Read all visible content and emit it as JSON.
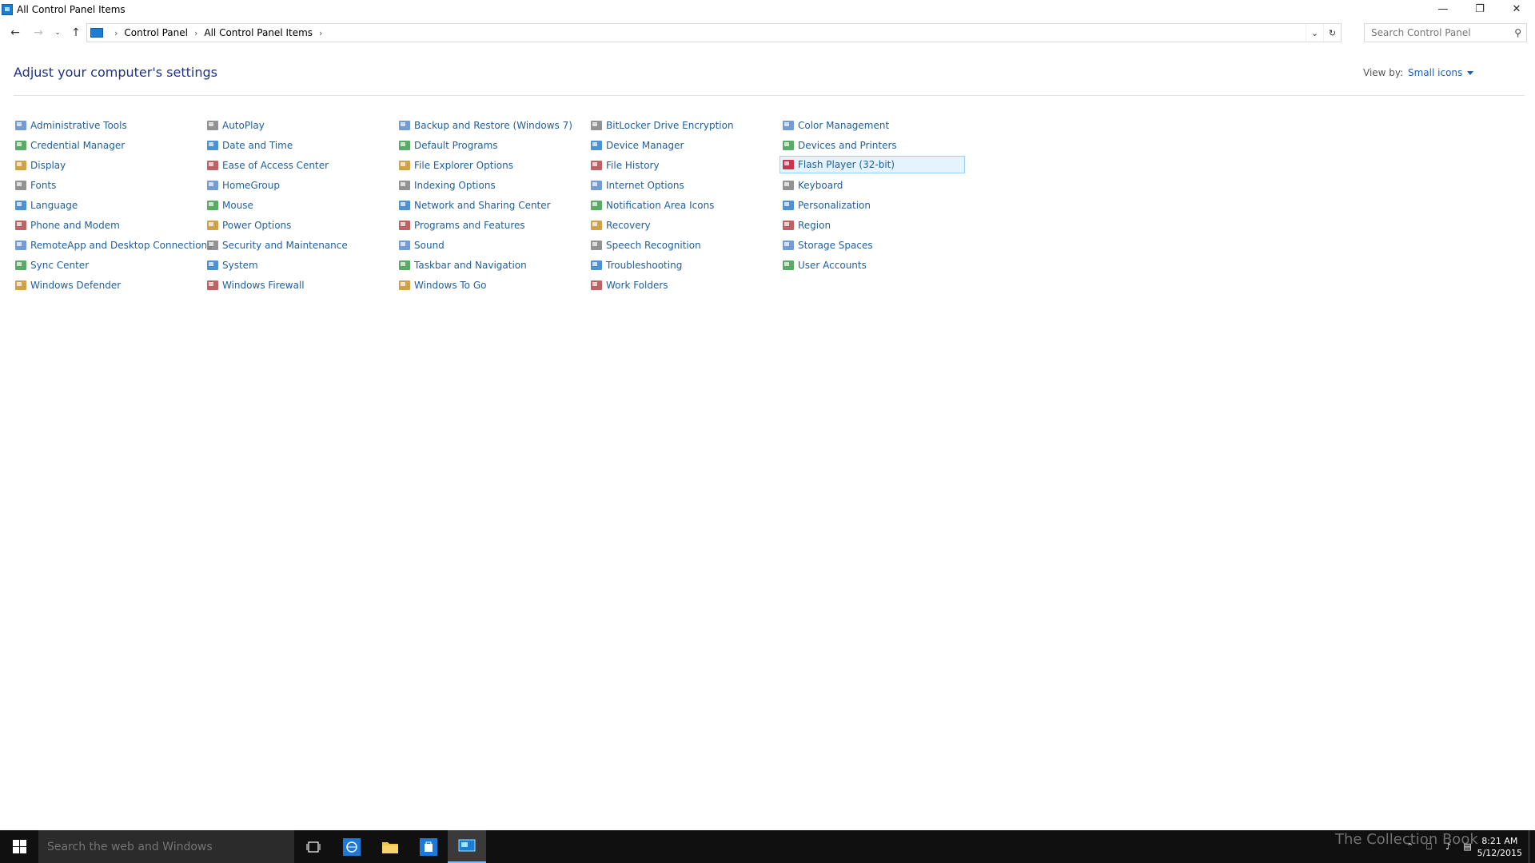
{
  "window": {
    "title": "All Control Panel Items"
  },
  "addressbar": {
    "crumbs": [
      "Control Panel",
      "All Control Panel Items"
    ],
    "search_placeholder": "Search Control Panel"
  },
  "header": {
    "title": "Adjust your computer's settings",
    "view_by_label": "View by:",
    "view_by_value": "Small icons"
  },
  "columns": [
    [
      "Administrative Tools",
      "Credential Manager",
      "Display",
      "Fonts",
      "Language",
      "Phone and Modem",
      "RemoteApp and Desktop Connections",
      "Sync Center",
      "Windows Defender"
    ],
    [
      "AutoPlay",
      "Date and Time",
      "Ease of Access Center",
      "HomeGroup",
      "Mouse",
      "Power Options",
      "Security and Maintenance",
      "System",
      "Windows Firewall"
    ],
    [
      "Backup and Restore (Windows 7)",
      "Default Programs",
      "File Explorer Options",
      "Indexing Options",
      "Network and Sharing Center",
      "Programs and Features",
      "Sound",
      "Taskbar and Navigation",
      "Windows To Go"
    ],
    [
      "BitLocker Drive Encryption",
      "Device Manager",
      "File History",
      "Internet Options",
      "Notification Area Icons",
      "Recovery",
      "Speech Recognition",
      "Troubleshooting",
      "Work Folders"
    ],
    [
      "Color Management",
      "Devices and Printers",
      "Flash Player (32-bit)",
      "Keyboard",
      "Personalization",
      "Region",
      "Storage Spaces",
      "User Accounts"
    ]
  ],
  "selected_item": "Flash Player (32-bit)",
  "taskbar": {
    "search_placeholder": "Search the web and Windows",
    "time": "8:21 AM",
    "date": "5/12/2015"
  },
  "watermark": "The Collection Book",
  "colors": {
    "link": "#1f5f9c",
    "title": "#1e3287",
    "selection": "#e5f3ff",
    "taskbar": "#101010"
  }
}
